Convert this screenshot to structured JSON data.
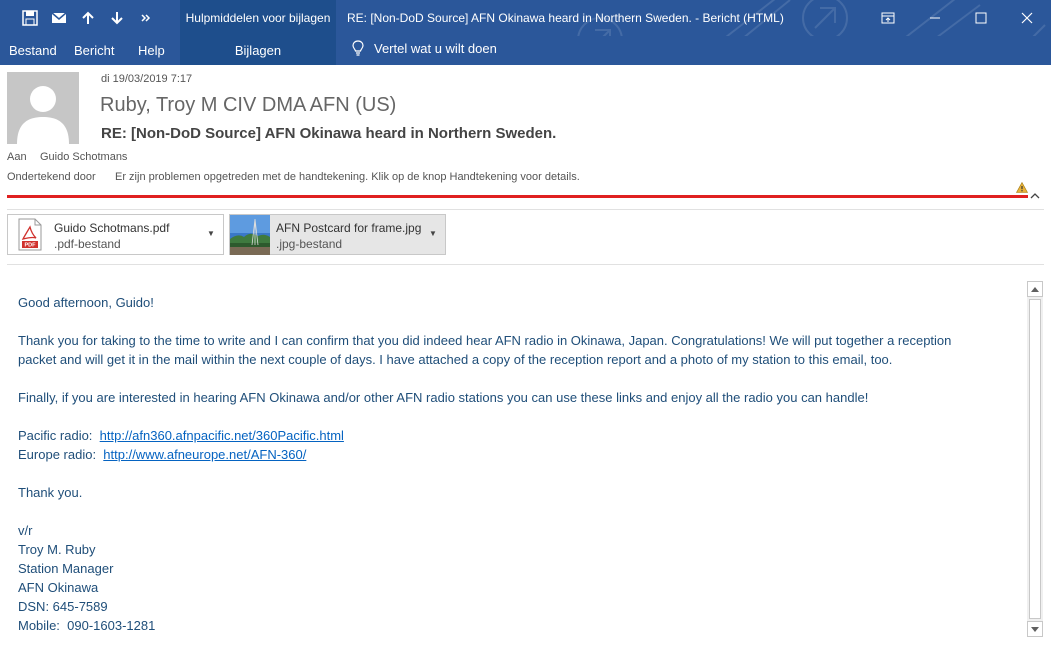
{
  "window": {
    "title": "RE: [Non-DoD Source] AFN Okinawa heard in Northern Sweden.  -  Bericht (HTML)",
    "context_group": "Hulpmiddelen voor bijlagen",
    "context_tab": "Bijlagen"
  },
  "ribbon": {
    "tabs": [
      "Bestand",
      "Bericht",
      "Help"
    ],
    "tell_me": "Vertel wat u wilt doen"
  },
  "message": {
    "date": "di 19/03/2019 7:17",
    "sender": "Ruby, Troy M CIV DMA AFN (US)",
    "subject": "RE: [Non-DoD Source] AFN Okinawa heard in Northern Sweden.",
    "to_label": "Aan",
    "to_name": "Guido Schotmans",
    "signed_label": "Ondertekend door",
    "signed_text": "Er zijn problemen opgetreden met de handtekening. Klik op de knop Handtekening voor details."
  },
  "attachments": [
    {
      "name": "Guido Schotmans.pdf",
      "type": ".pdf-bestand",
      "icon": "pdf-icon"
    },
    {
      "name": "AFN Postcard for frame.jpg",
      "type": ".jpg-bestand",
      "icon": "image-thumbnail"
    }
  ],
  "body": {
    "greeting": "Good afternoon, Guido!",
    "para1_line1": "Thank you for taking to the time to write and I can confirm that you did indeed hear AFN radio in Okinawa, Japan.  Congratulations!  We will put together a reception",
    "para1_line2": "packet and will get it in the mail within the next couple of days.  I have attached a copy of the reception report and a photo of my station to this email, too.",
    "para2": "Finally, if you are interested in hearing AFN Okinawa and/or other AFN radio stations you can use these links and enjoy all the radio you can handle!",
    "pacific_label": "Pacific radio:  ",
    "pacific_link": "http://afn360.afnpacific.net/360Pacific.html",
    "europe_label": "Europe radio:  ",
    "europe_link": "http://www.afneurope.net/AFN-360/",
    "thanks": "Thank you.",
    "sig": [
      "v/r",
      "Troy M. Ruby",
      "Station Manager",
      "AFN Okinawa",
      "DSN: 645-7589",
      "Mobile:  090-1603-1281"
    ]
  },
  "colors": {
    "titlebar": "#2b579a",
    "context": "#1e4e8c",
    "signature_error": "#e02020",
    "body_text": "#1f4e79",
    "link": "#0563c1"
  }
}
